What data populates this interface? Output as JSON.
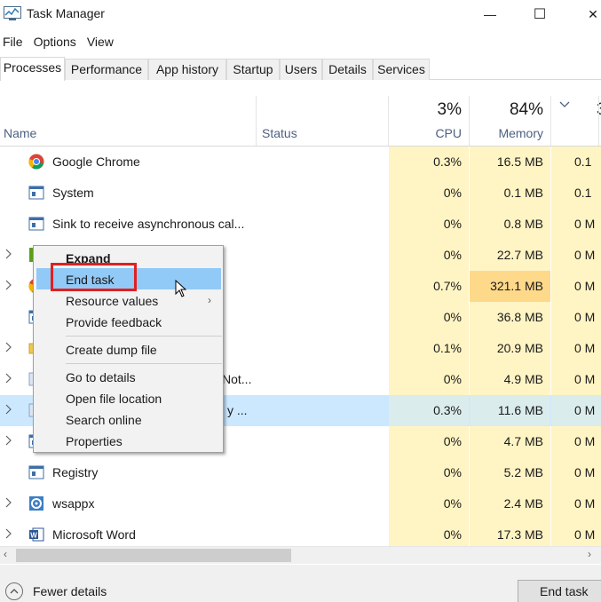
{
  "window": {
    "title": "Task Manager",
    "minimize_glyph": "—",
    "maximize_glyph": "☐",
    "close_glyph": "✕"
  },
  "menu": [
    "File",
    "Options",
    "View"
  ],
  "tabs": [
    "Processes",
    "Performance",
    "App history",
    "Startup",
    "Users",
    "Details",
    "Services"
  ],
  "active_tab": "Processes",
  "columns": {
    "name": "Name",
    "status": "Status",
    "cpu_pct": "3%",
    "cpu": "CPU",
    "memory_pct": "84%",
    "memory": "Memory",
    "disk_pct": "3"
  },
  "rows": [
    {
      "name": "Google Chrome",
      "icon": "chrome-icon",
      "expander": false,
      "cpu": "0.3%",
      "mem": "16.5 MB",
      "disk": "0.1 M"
    },
    {
      "name": "System",
      "icon": "system-window-icon",
      "expander": false,
      "cpu": "0%",
      "mem": "0.1 MB",
      "disk": "0.1 M"
    },
    {
      "name": "Sink to receive asynchronous cal...",
      "icon": "system-window-icon",
      "expander": false,
      "cpu": "0%",
      "mem": "0.8 MB",
      "disk": "0 M"
    },
    {
      "name": "",
      "icon": "nvidia-icon",
      "expander": true,
      "cpu": "0%",
      "mem": "22.7 MB",
      "disk": "0 M"
    },
    {
      "name": "",
      "icon": "chrome-icon",
      "expander": true,
      "cpu": "0.7%",
      "mem": "321.1 MB",
      "disk": "0 M",
      "mem_high": true
    },
    {
      "name": "",
      "icon": "system-window-icon",
      "expander": false,
      "cpu": "0%",
      "mem": "36.8 MB",
      "disk": "0 M"
    },
    {
      "name": "",
      "icon": "folder-icon",
      "expander": true,
      "cpu": "0.1%",
      "mem": "20.9 MB",
      "disk": "0 M"
    },
    {
      "name": "Not...",
      "icon": "app-icon",
      "expander": true,
      "cpu": "0%",
      "mem": "4.9 MB",
      "disk": "0 M"
    },
    {
      "name": "y ...",
      "icon": "app-icon",
      "expander": true,
      "cpu": "0.3%",
      "mem": "11.6 MB",
      "disk": "0 M",
      "selected": true
    },
    {
      "name": "",
      "icon": "system-window-icon",
      "expander": true,
      "cpu": "0%",
      "mem": "4.7 MB",
      "disk": "0 M"
    },
    {
      "name": "Registry",
      "icon": "system-window-icon",
      "expander": false,
      "cpu": "0%",
      "mem": "5.2 MB",
      "disk": "0 M"
    },
    {
      "name": "wsappx",
      "icon": "gear-icon",
      "expander": true,
      "cpu": "0%",
      "mem": "2.4 MB",
      "disk": "0 M"
    },
    {
      "name": "Microsoft Word",
      "icon": "word-icon",
      "expander": true,
      "cpu": "0%",
      "mem": "17.3 MB",
      "disk": "0 M"
    }
  ],
  "context_menu": {
    "expand": "Expand",
    "end_task": "End task",
    "resource_values": "Resource values",
    "provide_feedback": "Provide feedback",
    "create_dump": "Create dump file",
    "go_to_details": "Go to details",
    "open_file_location": "Open file location",
    "search_online": "Search online",
    "properties": "Properties"
  },
  "footer": {
    "fewer_details": "Fewer details",
    "end_task_button": "End task"
  },
  "colors": {
    "highlight": "#91c9f7",
    "selected_row": "#cce8ff",
    "heat_low": "#fff4c4",
    "heat_high": "#ffd98a",
    "annotation_red": "#e02020"
  }
}
